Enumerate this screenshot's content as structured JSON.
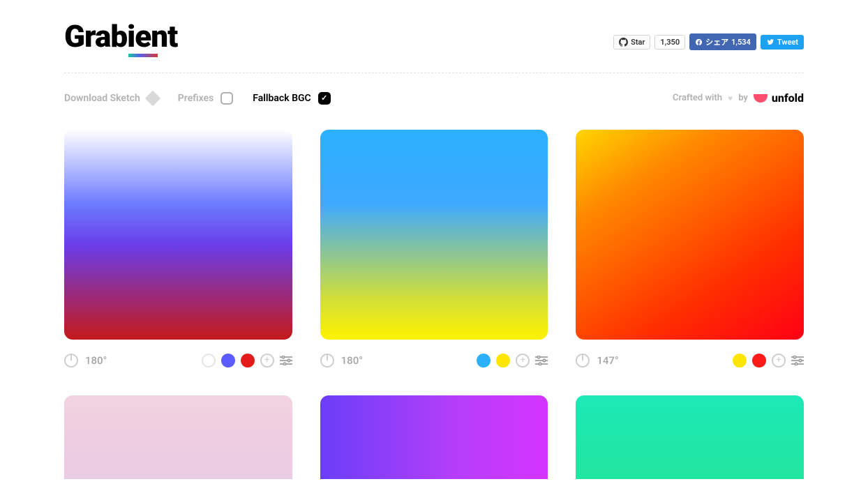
{
  "brand": {
    "name": "Grabient"
  },
  "social": {
    "github_star": "Star",
    "github_count": "1,350",
    "facebook_share": "シェア",
    "facebook_count": "1,534",
    "twitter": "Tweet"
  },
  "toolbar": {
    "download_sketch": "Download Sketch",
    "prefixes": "Prefixes",
    "fallback_bgc": "Fallback BGC",
    "crafted_with": "Crafted with",
    "by": "by",
    "unfold": "unfold"
  },
  "cards": [
    {
      "angle": "180°",
      "swatches": [
        "#ffffff",
        "#5b5bff",
        "#e31b1b"
      ]
    },
    {
      "angle": "180°",
      "swatches": [
        "#2bb0ff",
        "#ffe600"
      ]
    },
    {
      "angle": "147°",
      "swatches": [
        "#ffe600",
        "#ff1a1a"
      ]
    }
  ]
}
